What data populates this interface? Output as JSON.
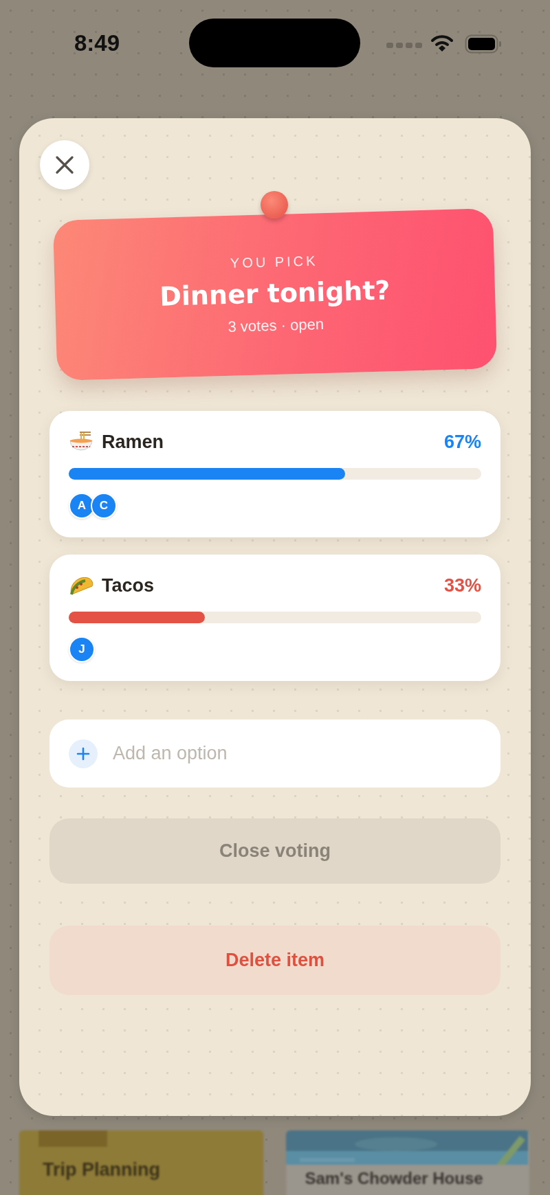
{
  "status_bar": {
    "time": "8:49"
  },
  "background_cards": [
    {
      "title": "Trip Planning",
      "kind": "note"
    },
    {
      "title": "Sam's Chowder House",
      "kind": "picture"
    }
  ],
  "poll": {
    "eyebrow": "YOU PICK",
    "title": "Dinner tonight?",
    "meta": "3 votes · open",
    "options": [
      {
        "kind": "bowl",
        "label": "Ramen",
        "percent": "67%",
        "level": 0.67,
        "color": "#1a84f5",
        "voters": [
          "A",
          "C"
        ]
      },
      {
        "kind": "taco",
        "label": "Tacos",
        "percent": "33%",
        "level": 0.33,
        "color": "#e35244",
        "voters": [
          "J"
        ]
      }
    ],
    "add_option": {
      "placeholder": "Add an option"
    },
    "buttons": [
      {
        "label": "Close voting",
        "kind": "neutral"
      },
      {
        "label": "Delete item",
        "kind": "danger"
      }
    ]
  }
}
